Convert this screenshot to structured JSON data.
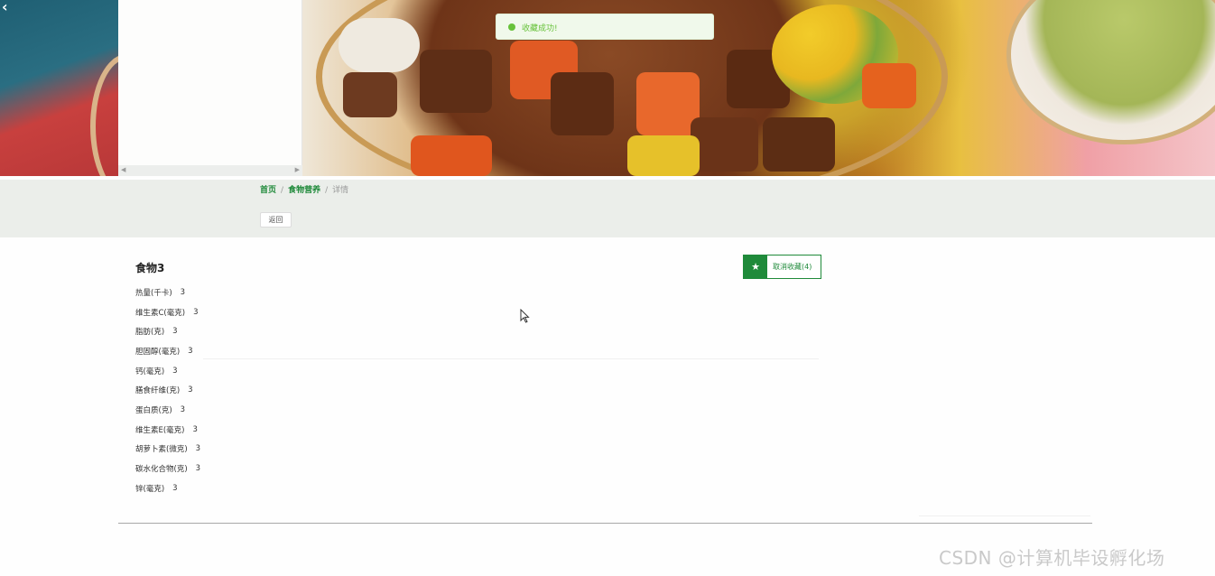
{
  "toast": {
    "message": "收藏成功!",
    "icon": "check-circle-icon",
    "color": "#67c23a"
  },
  "breadcrumb": {
    "home": "首页",
    "section": "食物营养",
    "current": "详情"
  },
  "back_button": {
    "label": "返回"
  },
  "food": {
    "title": "食物3",
    "favorite_button": {
      "label": "取消收藏(4)",
      "icon": "star-icon"
    },
    "nutrients": [
      {
        "name": "热量(千卡)",
        "value": "3"
      },
      {
        "name": "维生素C(毫克)",
        "value": "3"
      },
      {
        "name": "脂肪(克)",
        "value": "3"
      },
      {
        "name": "胆固醇(毫克)",
        "value": "3"
      },
      {
        "name": "钙(毫克)",
        "value": "3"
      },
      {
        "name": "膳食纤维(克)",
        "value": "3"
      },
      {
        "name": "蛋白质(克)",
        "value": "3"
      },
      {
        "name": "维生素E(毫克)",
        "value": "3"
      },
      {
        "name": "胡萝卜素(微克)",
        "value": "3"
      },
      {
        "name": "碳水化合物(克)",
        "value": "3"
      },
      {
        "name": "锌(毫克)",
        "value": "3"
      }
    ]
  },
  "watermark": "CSDN @计算机毕设孵化场",
  "colors": {
    "accent": "#1f8a3a",
    "band": "#ebeeea"
  }
}
